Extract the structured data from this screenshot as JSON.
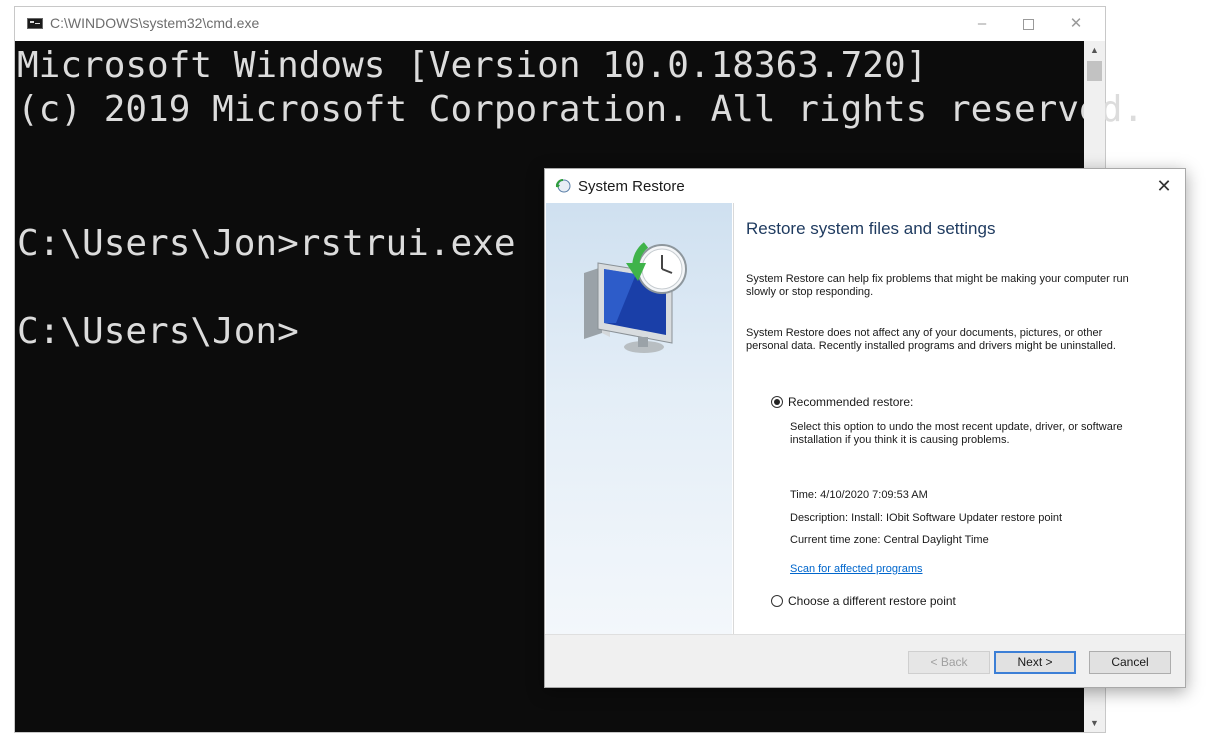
{
  "cmd": {
    "title": "C:\\WINDOWS\\system32\\cmd.exe",
    "controls": {
      "minimize": "–",
      "close": "✕"
    },
    "lines": [
      "Microsoft Windows [Version 10.0.18363.720]",
      "(c) 2019 Microsoft Corporation. All rights reserved.",
      "C:\\Users\\Jon>rstrui.exe",
      "C:\\Users\\Jon>"
    ],
    "scroll": {
      "up": "▲",
      "down": "▼"
    }
  },
  "dialog": {
    "title": "System Restore",
    "close": "✕",
    "heading": "Restore system files and settings",
    "para1": "System Restore can help fix problems that might be making your computer run slowly or stop responding.",
    "para2": "System Restore does not affect any of your documents, pictures, or other personal data. Recently installed programs and drivers might be uninstalled.",
    "recommended": {
      "label": "Recommended restore:",
      "selected": true,
      "description": "Select this option to undo the most recent update, driver, or software installation if you think it is causing problems.",
      "time": "Time: 4/10/2020 7:09:53 AM",
      "desc": "Description: Install: IObit Software Updater restore point",
      "timezone": "Current time zone: Central Daylight Time",
      "scan_link": "Scan for affected programs"
    },
    "different": {
      "label": "Choose a different restore point",
      "selected": false
    },
    "buttons": {
      "back": "< Back",
      "next": "Next >",
      "cancel": "Cancel"
    }
  },
  "colors": {
    "console_bg": "#0c0c0c",
    "console_text": "#dcdcdc",
    "link": "#0066cc",
    "heading": "#1e3a5f",
    "accent": "#3c7fd6"
  },
  "icons": {
    "cmd": "console-icon",
    "restore_title": "system-restore-icon",
    "restore_graphic": "monitor-clock-icon"
  }
}
